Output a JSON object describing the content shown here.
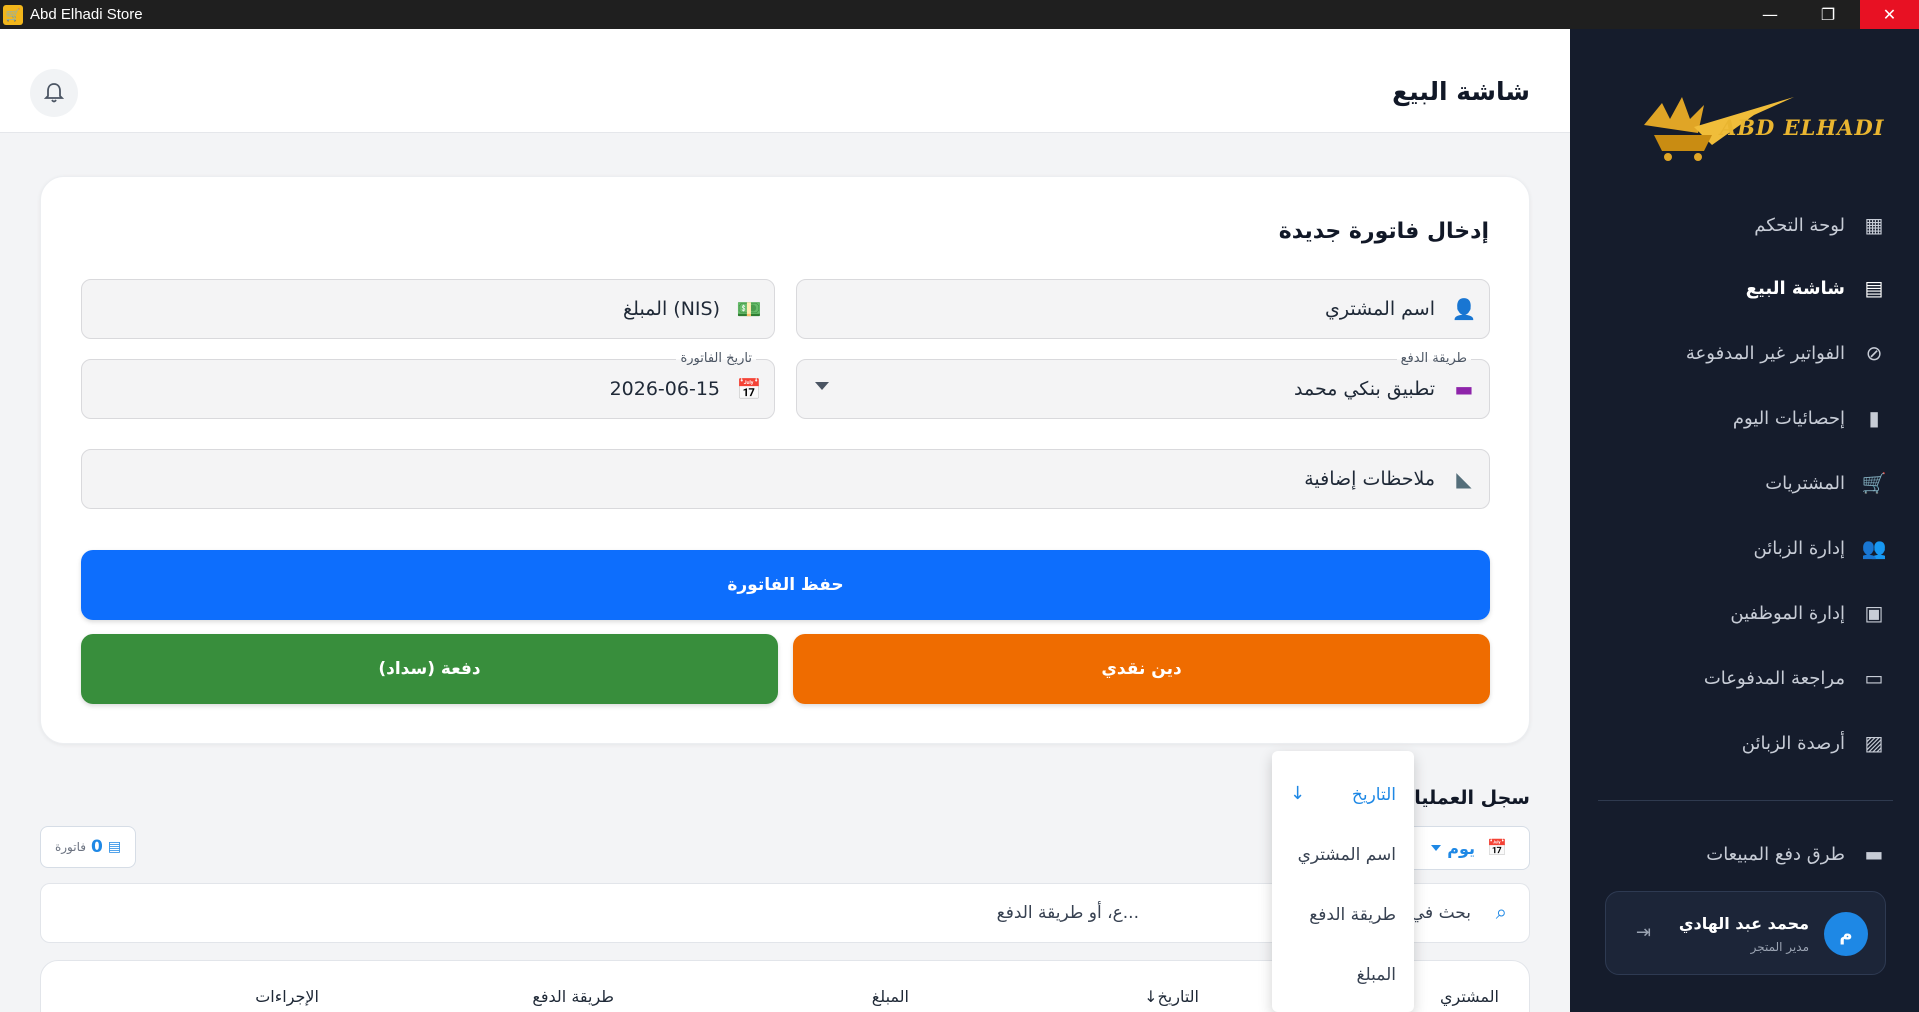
{
  "window": {
    "title": "Abd Elhadi Store",
    "app_icon": "cart-icon",
    "minimize": "—",
    "maximize": "❐",
    "close": "✕"
  },
  "sidebar": {
    "logo_text": "ABD ELHADI",
    "items": [
      {
        "label": "لوحة التحكم",
        "icon": "▦"
      },
      {
        "label": "شاشة البيع",
        "icon": "▤"
      },
      {
        "label": "الفواتير غير المدفوعة",
        "icon": "⊘"
      },
      {
        "label": "إحصائيات اليوم",
        "icon": "▮"
      },
      {
        "label": "المشتريات",
        "icon": "🛒"
      },
      {
        "label": "إدارة الزبائن",
        "icon": "👥"
      },
      {
        "label": "إدارة الموظفين",
        "icon": "▣"
      },
      {
        "label": "مراجعة المدفوعات",
        "icon": "▭"
      },
      {
        "label": "أرصدة الزبائن",
        "icon": "▨"
      },
      {
        "label": "طرق دفع المبيعات",
        "icon": "▬"
      }
    ],
    "active_index": 1,
    "user": {
      "initial": "م",
      "name": "محمد عبد الهادي",
      "role": "مدير المتجر",
      "logout_icon": "⇥"
    }
  },
  "header": {
    "title": "شاشة البيع",
    "bell_icon": "🔔"
  },
  "form": {
    "title": "إدخال فاتورة جديدة",
    "customer_placeholder": "اسم المشتري",
    "amount_placeholder": "المبلغ (NIS)",
    "payment_label": "طريقة الدفع",
    "payment_value": "تطبيق بنكي محمد",
    "date_label": "تاريخ الفاتورة",
    "date_value": "2026-06-15",
    "notes_placeholder": "ملاحظات إضافية",
    "save_button": "حفظ الفاتورة",
    "cash_debt_button": "دين نقدي",
    "payment_button": "دفعة (سداد)",
    "colors": {
      "primary": "#0d6efd",
      "orange": "#ef6c00",
      "green": "#388e3c"
    }
  },
  "log": {
    "title": "سجل العمليات",
    "period_filter": "يوم",
    "invoice_count": "0",
    "invoice_count_unit": "فاتورة",
    "search_placeholder": "بحث في",
    "search_placeholder_tail": "ع، أو طريقة الدفع...",
    "columns": [
      "المشتري",
      "التاريخ",
      "المبلغ",
      "طريقة الدفع",
      "الإجراءات"
    ]
  },
  "sort_menu": {
    "items": [
      "التاريخ",
      "اسم المشتري",
      "طريقة الدفع",
      "المبلغ"
    ],
    "active_index": 0,
    "active_arrow": "↓"
  }
}
